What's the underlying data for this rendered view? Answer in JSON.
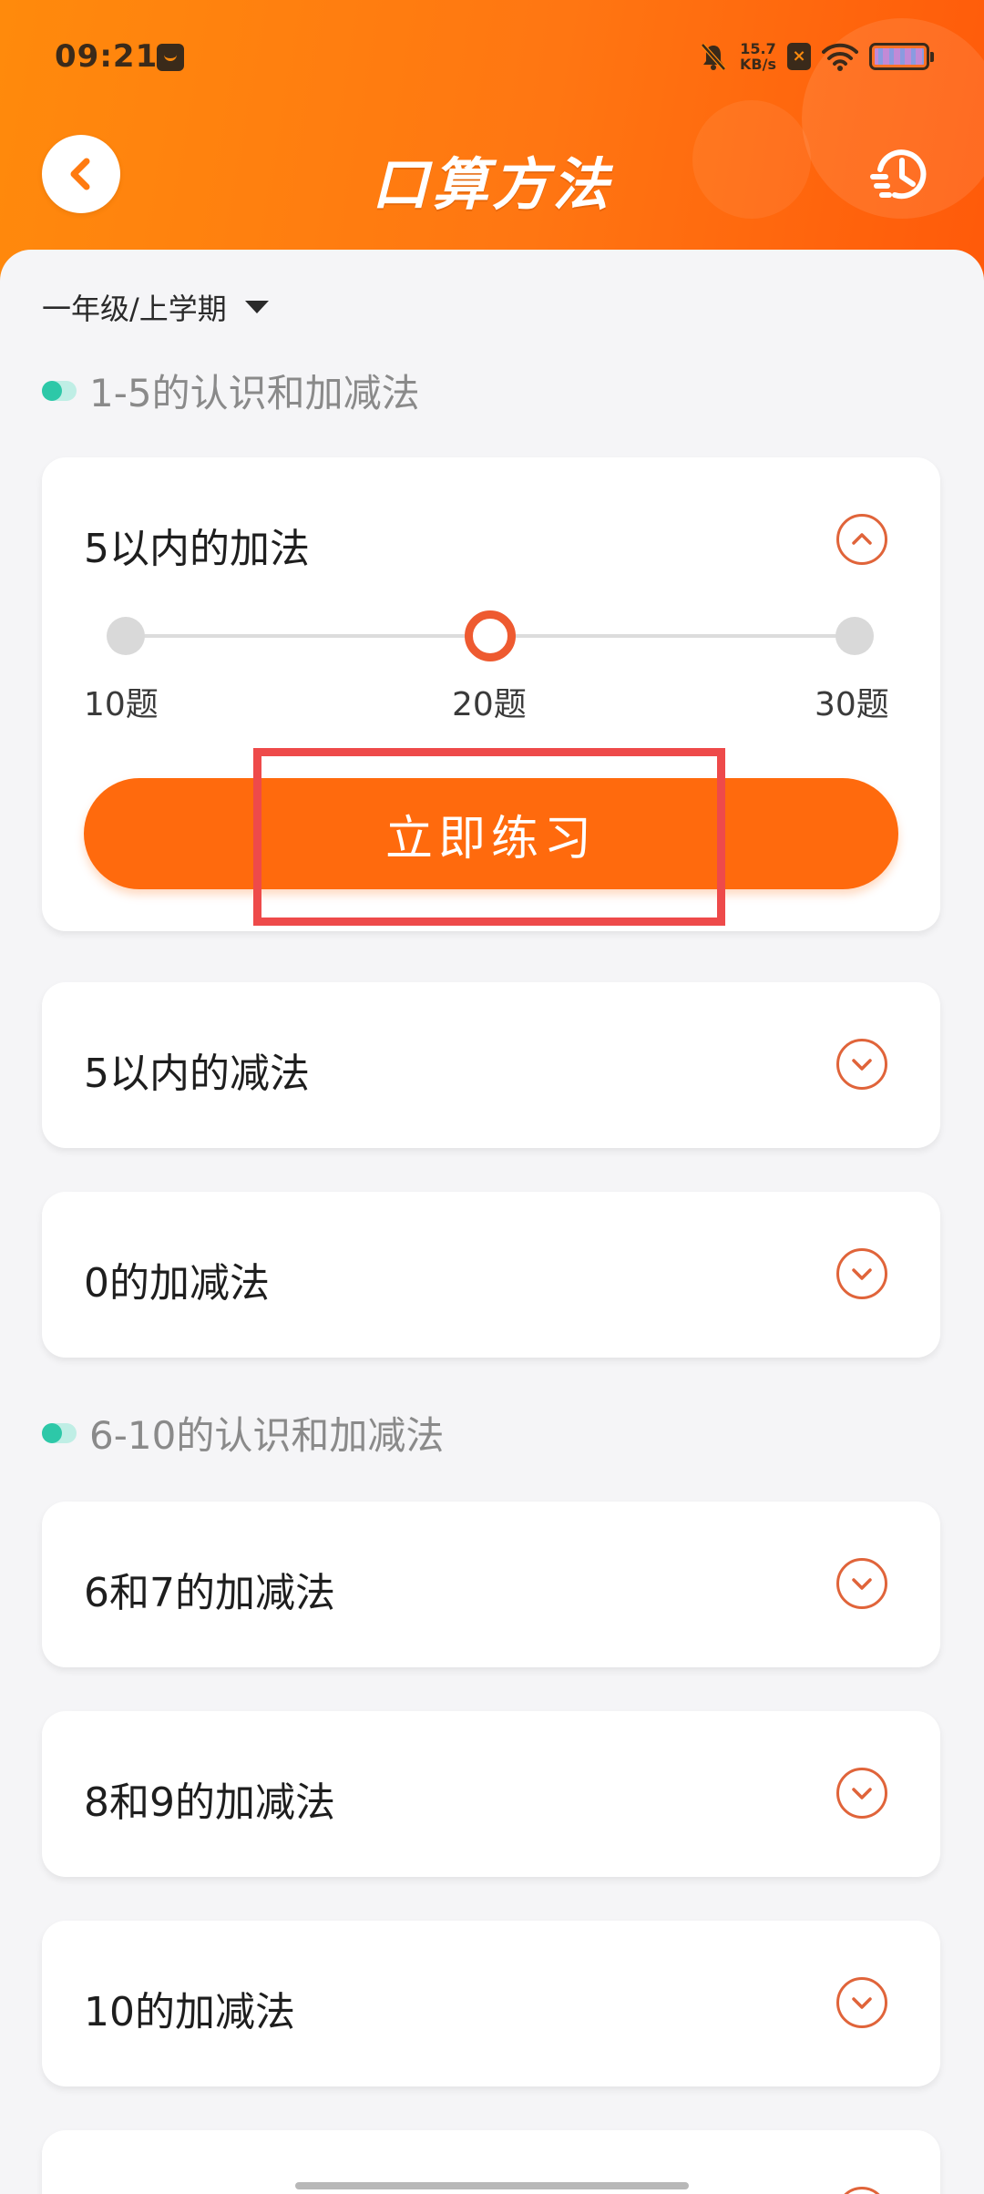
{
  "status_bar": {
    "time": "09:21",
    "net_speed_value": "15.7",
    "net_speed_unit": "KB/s",
    "sim_label": "×",
    "icons": [
      "app-notification-icon",
      "mute-bell-icon",
      "wifi-icon",
      "battery-icon"
    ]
  },
  "header": {
    "title": "口算方法",
    "back_icon": "back-chevron-icon",
    "history_icon": "history-clock-icon"
  },
  "grade_selector": {
    "value": "一年级/上学期",
    "caret_icon": "caret-down-icon"
  },
  "sections": [
    {
      "title": "1-5的认识和加减法",
      "items": [
        {
          "title": "5以内的加法",
          "expanded": true,
          "options": [
            "10题",
            "20题",
            "30题"
          ],
          "selected_option": "20题",
          "button_label": "立即练习"
        },
        {
          "title": "5以内的减法",
          "expanded": false
        },
        {
          "title": "0的加减法",
          "expanded": false
        }
      ]
    },
    {
      "title": "6-10的认识和加减法",
      "items": [
        {
          "title": "6和7的加减法",
          "expanded": false
        },
        {
          "title": "8和9的加减法",
          "expanded": false
        },
        {
          "title": "10的加减法",
          "expanded": false
        }
      ]
    }
  ],
  "colors": {
    "header_gradient_start": "#ff8a0c",
    "header_gradient_end": "#ff5a0a",
    "primary_button": "#ff6a0d",
    "chevron_accent": "#e0643a",
    "section_dot": "#2dc8a8",
    "highlight_box": "#ee4a4a"
  }
}
